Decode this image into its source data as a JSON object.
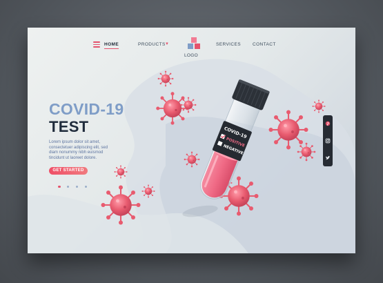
{
  "nav": {
    "home": "HOME",
    "products": "PRODUCTS",
    "logo": "LOGO",
    "services": "SERVICES",
    "contact": "CONTACT"
  },
  "hero": {
    "title": "COVID-19",
    "subtitle": "TEST",
    "body_lines": [
      "Lorem ipsum dolor sit amet,",
      "consectetuer adipiscing elit, sed",
      "diam nonummy nibh euismod",
      "tincidunt ut laoreet dolore."
    ],
    "cta": "GET STARTED"
  },
  "carousel": {
    "count": 4,
    "active": 1
  },
  "tube": {
    "label_title": "COVID-19",
    "option_positive": "POSITIVE",
    "option_negative": "NEGATIVE",
    "positive_checked": true,
    "negative_checked": false
  },
  "social": [
    "pinterest-icon",
    "instagram-icon",
    "twitter-icon"
  ],
  "colors": {
    "accent": "#e4526c",
    "title_blue": "#7f9dc7",
    "dark_text": "#1f2b3b",
    "tube_liquid": "#f06b86",
    "virus": "#e85b6f"
  }
}
